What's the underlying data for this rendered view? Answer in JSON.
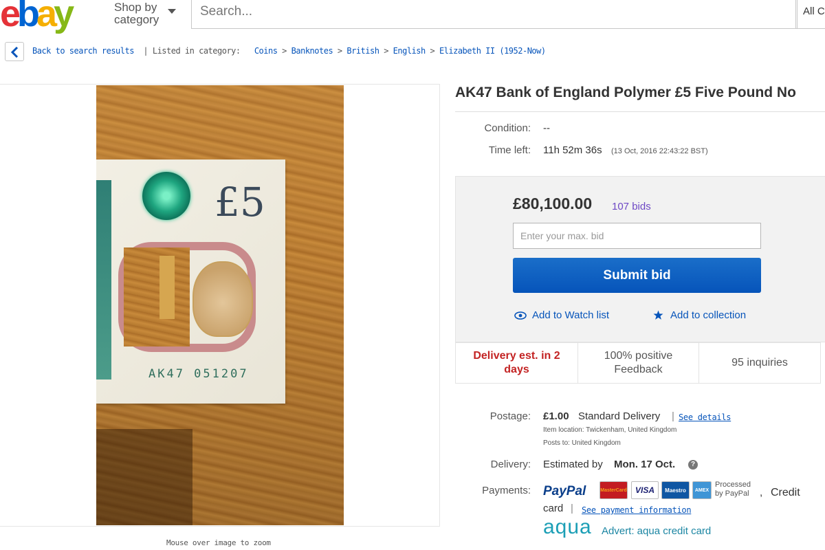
{
  "header": {
    "logo_letters": [
      "e",
      "b",
      "a",
      "y"
    ],
    "logo_colors": [
      "#e53238",
      "#0064d2",
      "#f5af02",
      "#86b817"
    ],
    "shop_by_line1": "Shop by",
    "shop_by_line2": "category",
    "search_placeholder": "Search...",
    "all_categories": "All C"
  },
  "breadcrumb": {
    "back": "Back to search results",
    "listed_in": "| Listed in category:",
    "items": [
      "Coins",
      "Banknotes",
      "British",
      "English",
      "Elizabeth II (1952-Now)"
    ],
    "separator": ">"
  },
  "image": {
    "note_symbol": "£5",
    "serial": "AK47 051207",
    "zoom_hint": "Mouse over image to zoom"
  },
  "listing": {
    "title": "AK47 Bank of England Polymer £5 Five Pound No",
    "condition_label": "Condition:",
    "condition_value": "--",
    "time_left_label": "Time left:",
    "time_left_value": "11h 52m 36s",
    "end_time": "(13 Oct, 2016   22:43:22 BST)"
  },
  "bid": {
    "price": "£80,100.00",
    "bids": "107 bids",
    "max_bid_placeholder": "Enter your max. bid",
    "submit": "Submit bid",
    "watch": "Add to Watch list",
    "collection": "Add to collection"
  },
  "stats": {
    "delivery": "Delivery est. in 2 days",
    "feedback": "100% positive Feedback",
    "inquiries": "95 inquiries"
  },
  "postage": {
    "label": "Postage:",
    "price": "£1.00",
    "method": "Standard Delivery",
    "separator": "|",
    "see_details": "See details",
    "location": "Item location:  Twickenham, United Kingdom",
    "posts_to": "Posts to:  United Kingdom"
  },
  "delivery": {
    "label": "Delivery:",
    "estimated_by": "Estimated by",
    "date": "Mon. 17 Oct."
  },
  "payments": {
    "label": "Payments:",
    "paypal": "PayPal",
    "visa": "VISA",
    "mastercard": "MasterCard",
    "maestro": "Maestro",
    "amex": "AMEX",
    "processed_line1": "Processed",
    "processed_line2": "by PayPal",
    "comma": ",",
    "credit": "Credit",
    "card": "card",
    "pipe": "|",
    "see_payment": "See payment information",
    "aqua_logo": "aqua",
    "advert": "Advert: aqua credit card"
  }
}
